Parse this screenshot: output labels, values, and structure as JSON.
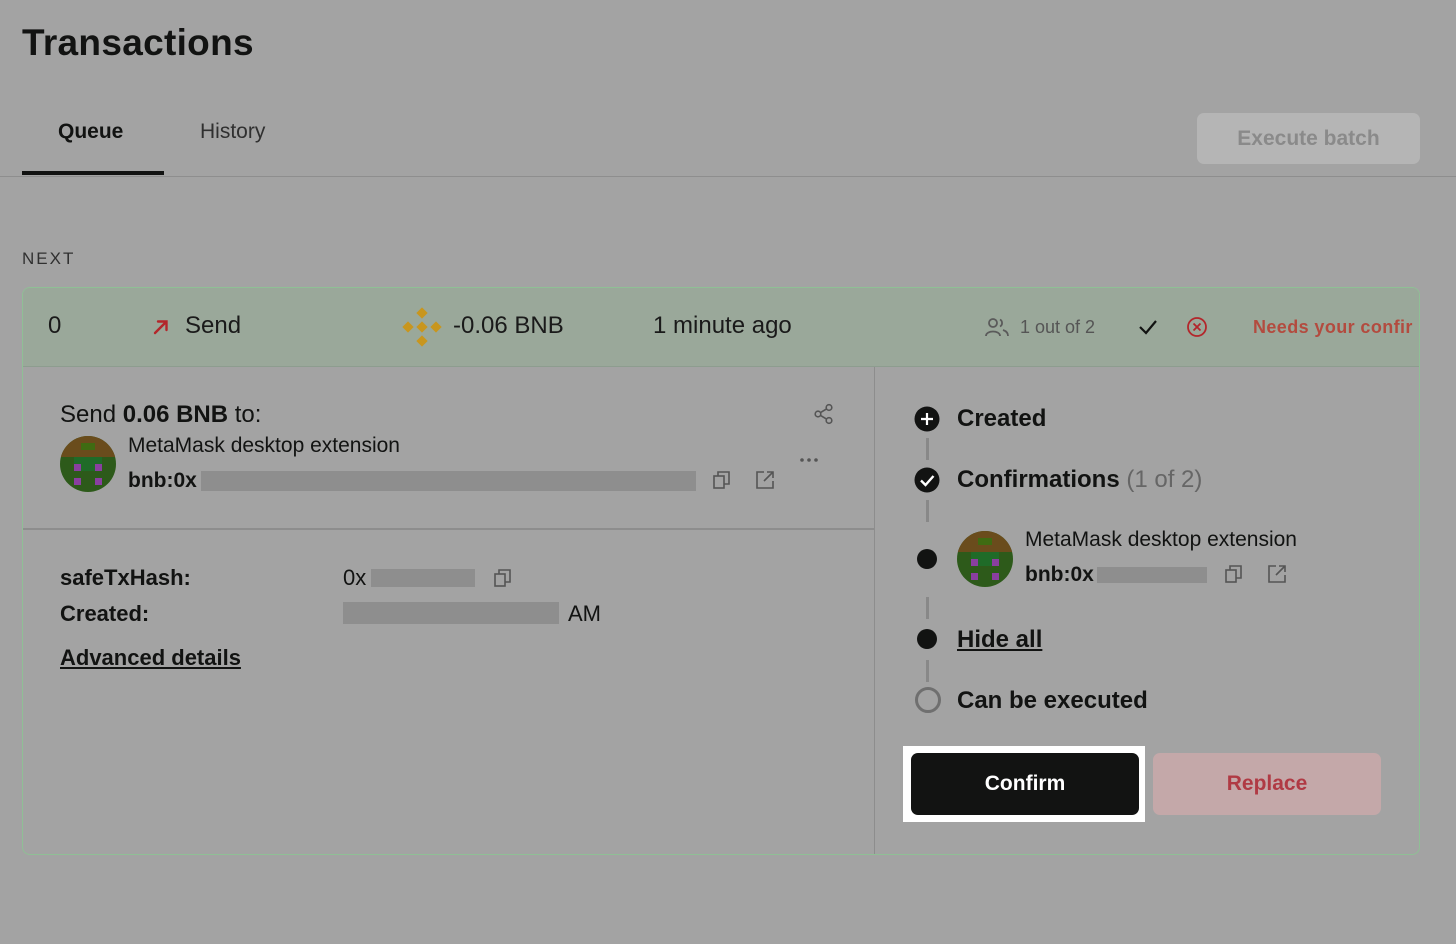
{
  "page": {
    "title": "Transactions"
  },
  "tabs": [
    {
      "label": "Queue",
      "active": true
    },
    {
      "label": "History",
      "active": false
    }
  ],
  "toolbar": {
    "execute_batch_label": "Execute batch"
  },
  "section": {
    "label": "NEXT"
  },
  "transaction": {
    "nonce": "0",
    "type_label": "Send",
    "amount": "-0.06 BNB",
    "time": "1 minute ago",
    "confirmations_summary": "1 out of 2",
    "status": "Needs your confir",
    "details": {
      "send_prefix": "Send ",
      "send_amount": "0.06 BNB",
      "send_suffix": " to:",
      "recipient_name": "MetaMask desktop extension",
      "recipient_address": "bnb:0x",
      "safe_tx_hash_label": "safeTxHash:",
      "safe_tx_hash_value": "0x",
      "created_label": "Created:",
      "created_value": "AM",
      "advanced_details": "Advanced details"
    },
    "timeline": {
      "created": "Created",
      "confirmations": "Confirmations",
      "confirmations_count": "(1 of 2)",
      "signer_name": "MetaMask desktop extension",
      "signer_address": "bnb:0x",
      "hide_all": "Hide all",
      "can_be_executed": "Can be executed"
    },
    "actions": {
      "confirm": "Confirm",
      "replace": "Replace"
    }
  },
  "colors": {
    "accent_dark": "#121312",
    "error": "#b34b3f",
    "bnb": "#c8961e",
    "card_border": "#8fbf95"
  },
  "icons": [
    "outgoing-arrow-icon",
    "bnb-token-icon",
    "owners-icon",
    "check-icon",
    "reject-icon",
    "share-icon",
    "copy-icon",
    "external-link-icon",
    "more-icon",
    "created-plus-icon",
    "confirmed-check-icon"
  ]
}
